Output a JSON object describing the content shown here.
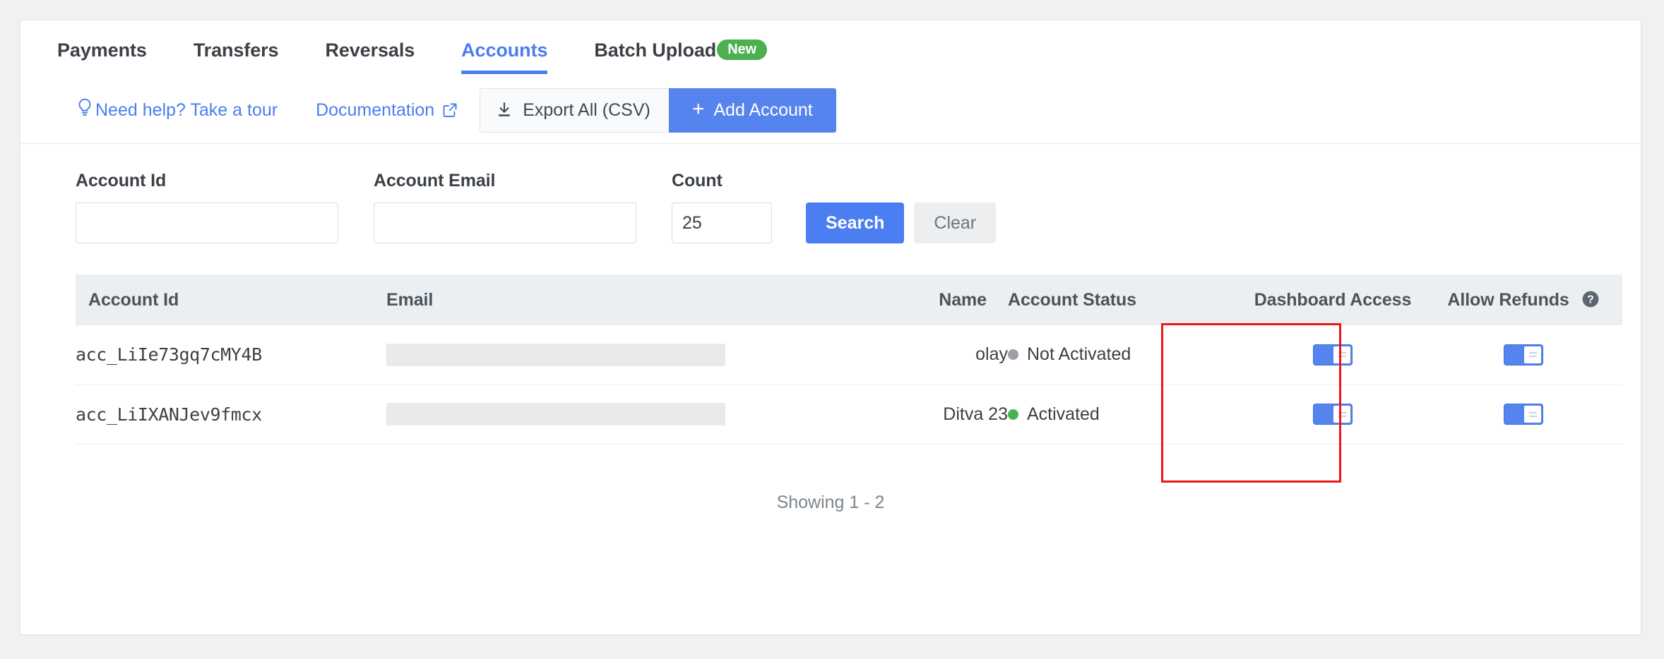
{
  "colors": {
    "accent_blue": "#4c7df0",
    "primary_button": "#5684ee",
    "badge_green": "#4caf50",
    "highlight_red": "#f01616",
    "status_grey": "#9aa0a6",
    "status_green": "#4caf50",
    "header_bg": "#eceff1",
    "page_bg": "#eff1f3"
  },
  "tabs": [
    {
      "label": "Payments",
      "active": false
    },
    {
      "label": "Transfers",
      "active": false
    },
    {
      "label": "Reversals",
      "active": false
    },
    {
      "label": "Accounts",
      "active": true
    },
    {
      "label": "Batch Upload",
      "active": false,
      "badge": "New"
    }
  ],
  "toolbar": {
    "tour_label": "Need help? Take a tour",
    "tour_icon": "lightbulb-icon",
    "documentation_label": "Documentation",
    "documentation_icon": "external-link-icon",
    "export_label": "Export All (CSV)",
    "export_icon": "download-icon",
    "add_account_label": "Add Account",
    "add_account_icon": "plus-icon"
  },
  "filters": {
    "account_id": {
      "label": "Account Id",
      "value": "",
      "placeholder": ""
    },
    "account_email": {
      "label": "Account Email",
      "value": "",
      "placeholder": ""
    },
    "count": {
      "label": "Count",
      "value": "25",
      "placeholder": ""
    },
    "search_label": "Search",
    "clear_label": "Clear"
  },
  "table": {
    "columns": [
      {
        "key": "account_id",
        "label": "Account Id"
      },
      {
        "key": "email",
        "label": "Email"
      },
      {
        "key": "name",
        "label": "Name"
      },
      {
        "key": "account_status",
        "label": "Account Status"
      },
      {
        "key": "dashboard_access",
        "label": "Dashboard Access"
      },
      {
        "key": "allow_refunds",
        "label": "Allow Refunds",
        "help_icon": "help-circle-icon"
      }
    ],
    "rows": [
      {
        "account_id": "acc_LiIe73gq7cMY4B",
        "email": "",
        "email_redacted": true,
        "name": "olay",
        "account_status": "Not Activated",
        "account_status_state": "inactive",
        "dashboard_access": "on",
        "allow_refunds": "on"
      },
      {
        "account_id": "acc_LiIXANJev9fmcx",
        "email": "",
        "email_redacted": true,
        "name": "Ditva 23",
        "account_status": "Activated",
        "account_status_state": "active",
        "dashboard_access": "on",
        "allow_refunds": "on"
      }
    ]
  },
  "footer": {
    "showing": "Showing 1 - 2"
  },
  "annotation": {
    "target_column": "Dashboard Access"
  }
}
